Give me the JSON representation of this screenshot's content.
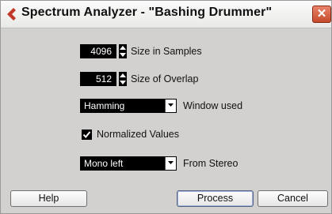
{
  "window": {
    "title": "Spectrum Analyzer - \"Bashing Drummer\"",
    "accent_color": "#c0392b"
  },
  "fields": {
    "size_in_samples": {
      "value": "4096",
      "label": "Size in Samples"
    },
    "size_of_overlap": {
      "value": "512",
      "label": "Size of Overlap"
    },
    "window_used": {
      "selected": "Hamming",
      "label": "Window used"
    },
    "normalized_values": {
      "checked": true,
      "label": "Normalized Values"
    },
    "from_stereo": {
      "selected": "Mono left",
      "label": "From Stereo"
    }
  },
  "buttons": {
    "help": "Help",
    "process": "Process",
    "cancel": "Cancel"
  },
  "icons": {
    "app": "cubase-arrow-icon",
    "close": "close-icon",
    "spin": "spin-up-down-icon",
    "dropdown": "chevron-down-icon",
    "check": "checkmark-icon"
  }
}
